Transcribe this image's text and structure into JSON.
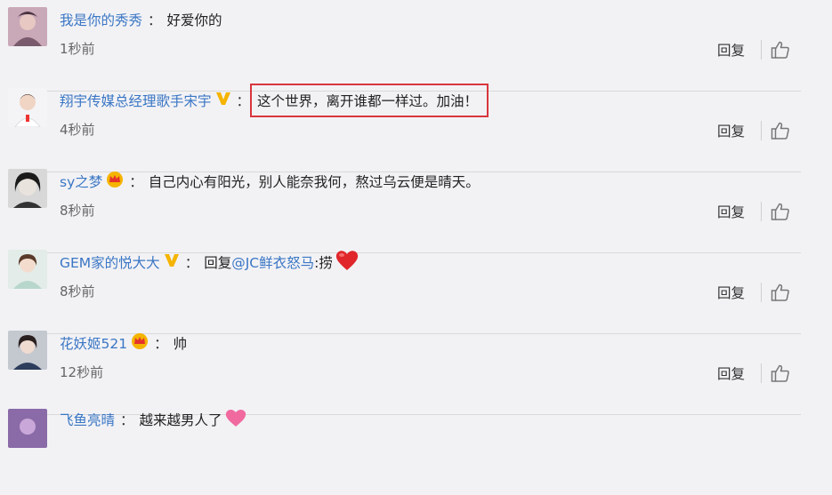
{
  "comments": [
    {
      "username": "我是你的秀秀",
      "badge": "",
      "text": "好爱你的",
      "time": "1秒前",
      "reply_label": "回复"
    },
    {
      "username": "翔宇传媒总经理歌手宋宇",
      "badge": "v-verified",
      "text": "这个世界，离开谁都一样过。加油！",
      "time": "4秒前",
      "reply_label": "回复",
      "highlighted": true
    },
    {
      "username": "sy之梦",
      "badge": "crown-member",
      "text": "自己内心有阳光，别人能奈我何，熬过乌云便是晴天。",
      "time": "8秒前",
      "reply_label": "回复"
    },
    {
      "username": "GEM家的悦大大",
      "badge": "v-verified",
      "text_prefix": "回复",
      "mention": "@JC鲜衣怒马",
      "text_suffix": ":捞",
      "emoji": "red-heart",
      "time": "8秒前",
      "reply_label": "回复"
    },
    {
      "username": "花妖姬521",
      "badge": "crown-member",
      "text": "帅",
      "time": "12秒前",
      "reply_label": "回复"
    },
    {
      "username": "飞鱼亮晴",
      "badge": "",
      "text": "越来越男人了",
      "emoji": "pink-heart",
      "time": "",
      "reply_label": ""
    }
  ],
  "colors": {
    "link_blue": "#3a76c4",
    "highlight_red": "#d9363e",
    "background": "#f2f2f5",
    "badge_gold": "#f5b400",
    "heart_red": "#e0262b"
  }
}
